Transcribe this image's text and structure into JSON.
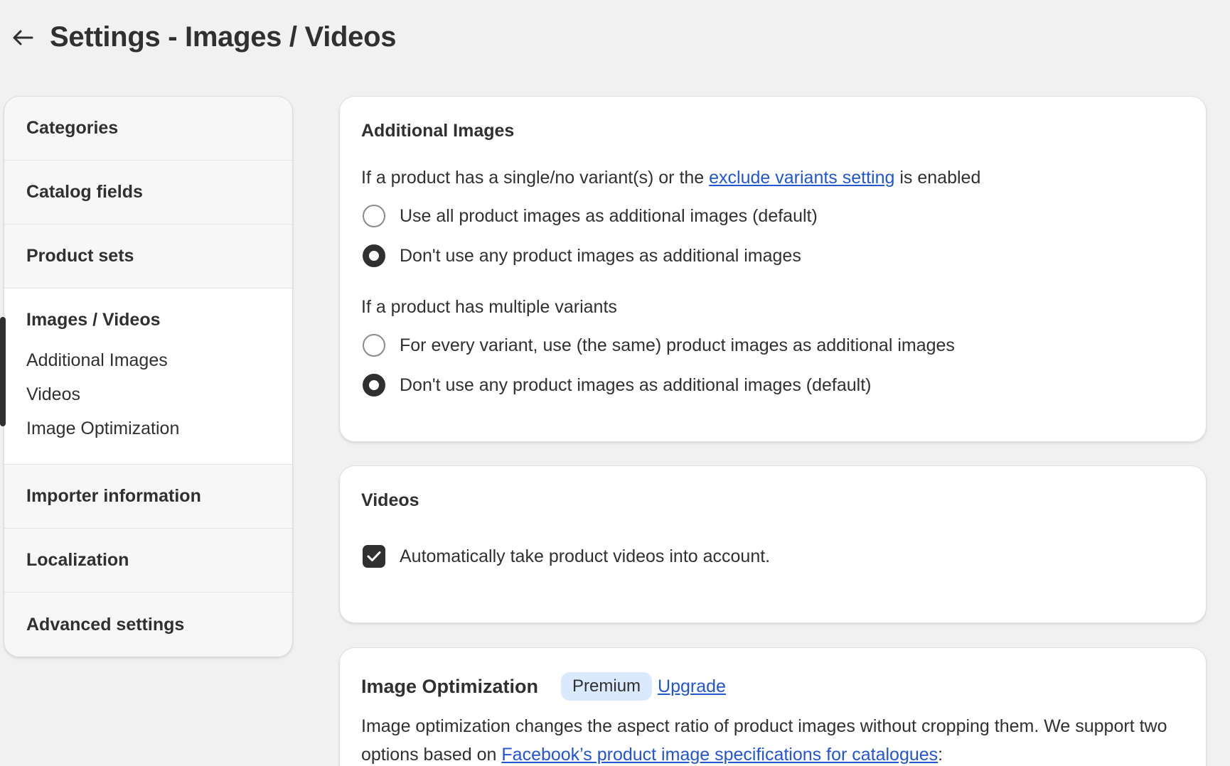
{
  "header": {
    "title": "Settings - Images / Videos"
  },
  "sidebar": {
    "items_top": [
      {
        "label": "Categories"
      },
      {
        "label": "Catalog fields"
      },
      {
        "label": "Product sets"
      }
    ],
    "active": {
      "label": "Images / Videos",
      "subitems": [
        {
          "label": "Additional Images"
        },
        {
          "label": "Videos"
        },
        {
          "label": "Image Optimization"
        }
      ]
    },
    "items_bottom": [
      {
        "label": "Importer information"
      },
      {
        "label": "Localization"
      },
      {
        "label": "Advanced settings"
      }
    ]
  },
  "additional_images": {
    "title": "Additional Images",
    "single_intro_before": "If a product has a single/no variant(s) or the ",
    "single_intro_link": "exclude variants setting",
    "single_intro_after": " is enabled",
    "single_options": [
      {
        "label": "Use all product images as additional images (default)",
        "checked": false
      },
      {
        "label": "Don't use any product images as additional images",
        "checked": true
      }
    ],
    "multi_intro": "If a product has multiple variants",
    "multi_options": [
      {
        "label": "For every variant, use (the same) product images as additional images",
        "checked": false
      },
      {
        "label": "Don't use any product images as additional images (default)",
        "checked": true
      }
    ]
  },
  "videos": {
    "title": "Videos",
    "checkbox_label": "Automatically take product videos into account.",
    "checked": true
  },
  "image_optimization": {
    "title": "Image Optimization",
    "badge": "Premium",
    "upgrade_link": "Upgrade",
    "desc_before": "Image optimization changes the aspect ratio of product images without cropping them. We support two options based on ",
    "desc_link": "Facebook’s product image specifications for catalogues",
    "desc_after": ":"
  }
}
